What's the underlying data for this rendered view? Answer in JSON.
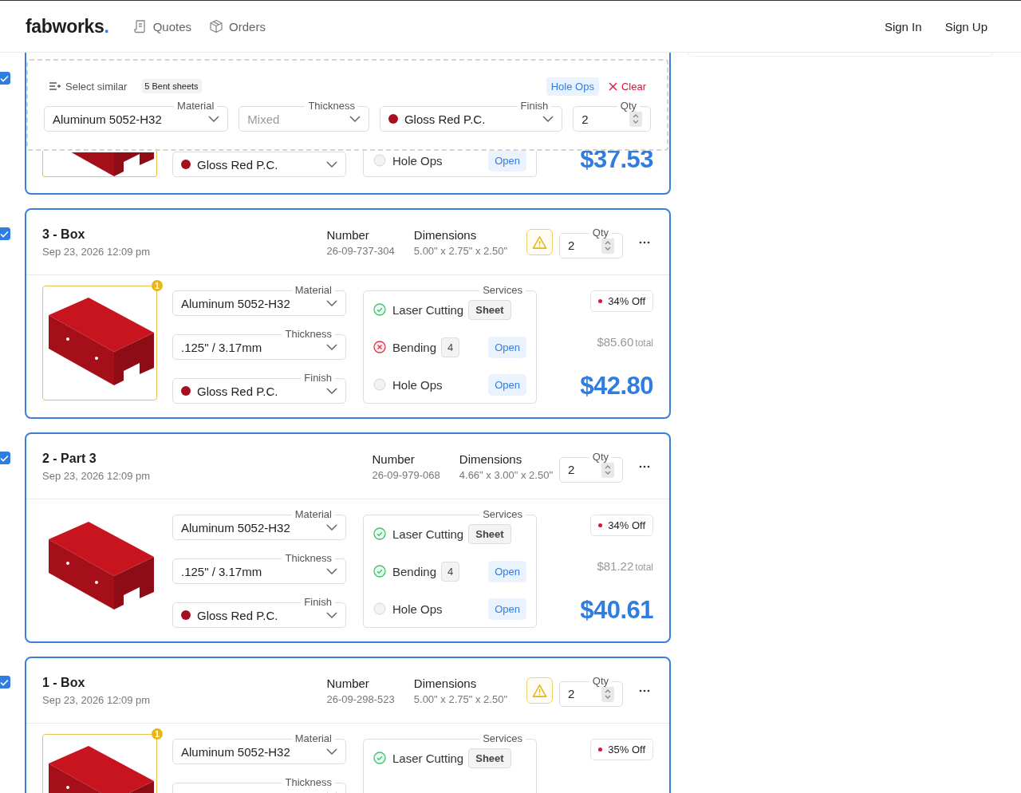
{
  "nav": {
    "logo": "fabworks",
    "logo_mark": ".",
    "links": [
      {
        "label": "Quotes",
        "kind": "quotes"
      },
      {
        "label": "Orders",
        "kind": "orders"
      }
    ],
    "auth": [
      "Sign In",
      "Sign Up"
    ]
  },
  "bulk_bar": {
    "select_similar": "Select similar",
    "selection": "5 Bent sheets",
    "chip": "Hole Ops",
    "clear": "Clear",
    "fields": [
      {
        "label": "Material",
        "value": "Aluminum 5052-H32",
        "kind": "select"
      },
      {
        "label": "Thickness",
        "placeholder": "Mixed",
        "kind": "select"
      },
      {
        "label": "Finish",
        "value": "Gloss Red P.C.",
        "kind": "select",
        "color": "#a50f1f"
      },
      {
        "label": "Qty",
        "value": "2",
        "kind": "number"
      }
    ]
  },
  "parts": [
    {
      "kind": "partial",
      "checked": true,
      "highlighted": true,
      "fields": [
        {
          "value": "Gloss Red P.C.",
          "kind": "select",
          "color": "#a50f1f"
        }
      ],
      "services": [
        {
          "name": "Hole Ops",
          "kind": "none",
          "action": "Open"
        }
      ],
      "price": "$37.53"
    },
    {
      "kind": "full",
      "checked": true,
      "title": "3 - Box",
      "date": "Sep 23, 2026 12:09 pm",
      "number_label": "Number",
      "number": "26-09-737-304",
      "dims_label": "Dimensions",
      "dims": "5.00\" x 2.75\" x 2.50\"",
      "warning": true,
      "qty_label": "Qty",
      "qty": "2",
      "highlighted": true,
      "thumb_badge": "1",
      "fields": [
        {
          "label": "Material",
          "value": "Aluminum 5052-H32",
          "kind": "select"
        },
        {
          "label": "Thickness",
          "value": ".125\" / 3.17mm",
          "kind": "select"
        },
        {
          "label": "Finish",
          "value": "Gloss Red P.C.",
          "kind": "select",
          "color": "#a50f1f"
        }
      ],
      "services_label": "Services",
      "services": [
        {
          "name": "Laser Cutting",
          "kind": "done",
          "tag": "Sheet"
        },
        {
          "name": "Bending",
          "kind": "failed",
          "count": "4",
          "action": "Open"
        },
        {
          "name": "Hole Ops",
          "kind": "none",
          "action": "Open"
        }
      ],
      "discount": "34% Off",
      "total": "$85.60",
      "total_suffix": "total",
      "price": "$42.80"
    },
    {
      "kind": "full",
      "checked": true,
      "title": "2 - Part 3",
      "date": "Sep 23, 2026 12:09 pm",
      "number_label": "Number",
      "number": "26-09-979-068",
      "dims_label": "Dimensions",
      "dims": "4.66\" x 3.00\" x 2.50\"",
      "warning": false,
      "qty_label": "Qty",
      "qty": "2",
      "highlighted": false,
      "fields": [
        {
          "label": "Material",
          "value": "Aluminum 5052-H32",
          "kind": "select"
        },
        {
          "label": "Thickness",
          "value": ".125\" / 3.17mm",
          "kind": "select"
        },
        {
          "label": "Finish",
          "value": "Gloss Red P.C.",
          "kind": "select",
          "color": "#a50f1f"
        }
      ],
      "services_label": "Services",
      "services": [
        {
          "name": "Laser Cutting",
          "kind": "done",
          "tag": "Sheet"
        },
        {
          "name": "Bending",
          "kind": "done",
          "count": "4",
          "action": "Open"
        },
        {
          "name": "Hole Ops",
          "kind": "none",
          "action": "Open"
        }
      ],
      "discount": "34% Off",
      "total": "$81.22",
      "total_suffix": "total",
      "price": "$40.61"
    },
    {
      "kind": "full",
      "checked": true,
      "title": "1 - Box",
      "date": "Sep 23, 2026 12:09 pm",
      "number_label": "Number",
      "number": "26-09-298-523",
      "dims_label": "Dimensions",
      "dims": "5.00\" x 2.75\" x 2.50\"",
      "warning": true,
      "qty_label": "Qty",
      "qty": "2",
      "highlighted": true,
      "thumb_badge": "1",
      "fields": [
        {
          "label": "Material",
          "value": "Aluminum 5052-H32",
          "kind": "select"
        },
        {
          "label": "Thickness",
          "kind": "select"
        }
      ],
      "services_label": "Services",
      "services": [
        {
          "name": "Laser Cutting",
          "kind": "done",
          "tag": "Sheet"
        }
      ],
      "discount": "35% Off"
    }
  ]
}
